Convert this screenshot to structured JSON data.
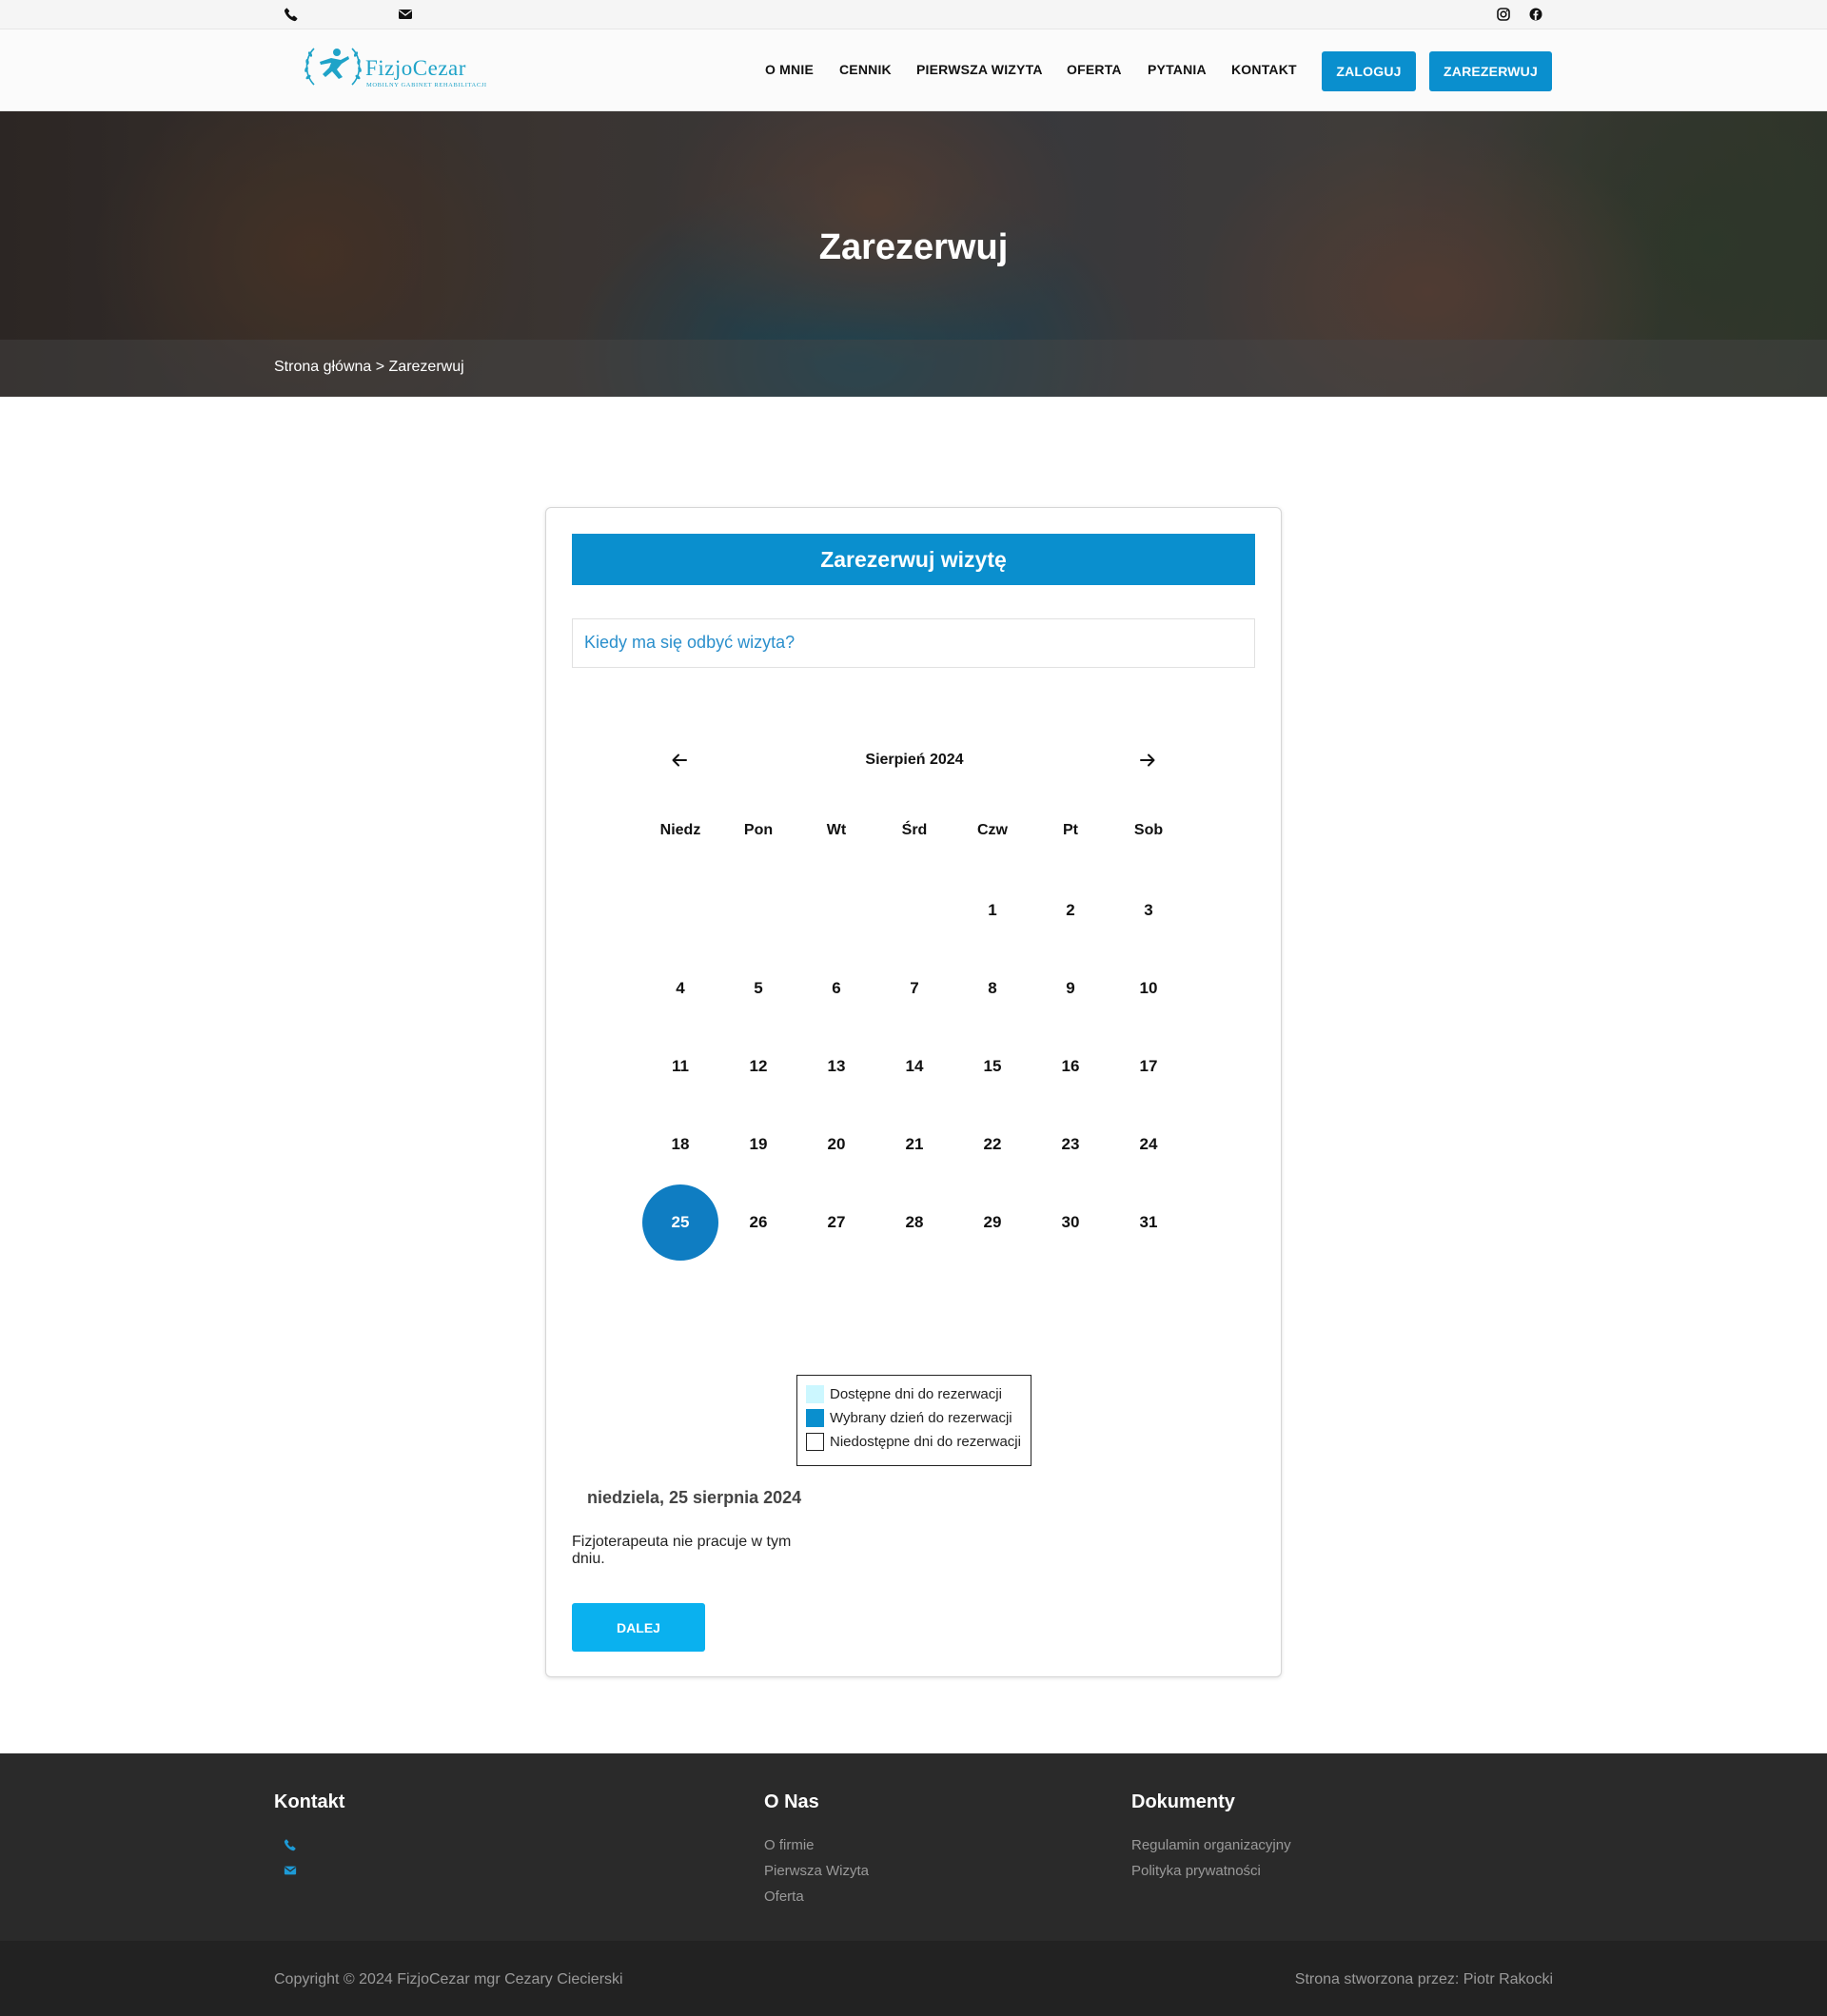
{
  "topbar": {
    "phone_icon": "phone-icon",
    "email_icon": "envelope-icon",
    "social": [
      "instagram-icon",
      "facebook-icon"
    ]
  },
  "header": {
    "logo_name": "FizjoCezar",
    "logo_tagline": "MOBILNY GABINET REHABILITACJI",
    "nav": [
      "O MNIE",
      "CENNIK",
      "PIERWSZA WIZYTA",
      "OFERTA",
      "PYTANIA",
      "KONTAKT"
    ],
    "login_label": "ZALOGUJ",
    "book_label": "ZAREZERWUJ",
    "accent_color": "#0a8fce"
  },
  "hero": {
    "title": "Zarezerwuj",
    "breadcrumb": "Strona główna > Zarezerwuj"
  },
  "booking": {
    "title": "Zarezerwuj wizytę",
    "question": "Kiedy ma się odbyć wizyta?",
    "month": "Sierpień 2024",
    "weekdays": [
      "Niedz",
      "Pon",
      "Wt",
      "Śrd",
      "Czw",
      "Pt",
      "Sob"
    ],
    "first_weekday_index": 4,
    "days_in_month": 31,
    "selected_day": 25,
    "selected_color": "#0f7dc2",
    "legend": [
      {
        "label": "Dostępne dni do rezerwacji",
        "color": "#ccf7ff"
      },
      {
        "label": "Wybrany dzień do rezerwacji",
        "color": "#0a8fce"
      },
      {
        "label": "Niedostępne dni do rezerwacji",
        "color": "#ffffff"
      }
    ],
    "selected_date_text": "niedziela, 25 sierpnia 2024",
    "message": "Fizjoterapeuta nie pracuje w tym dniu.",
    "next_label": "DALEJ"
  },
  "footer": {
    "contact_title": "Kontakt",
    "about_title": "O Nas",
    "about_links": [
      "O firmie",
      "Pierwsza Wizyta",
      "Oferta"
    ],
    "docs_title": "Dokumenty",
    "docs_links": [
      "Regulamin organizacyjny",
      "Polityka prywatności"
    ],
    "copyright": "Copyright © 2024 FizjoCezar mgr Cezary Ciecierski",
    "credit": "Strona stworzona przez: Piotr Rakocki"
  }
}
